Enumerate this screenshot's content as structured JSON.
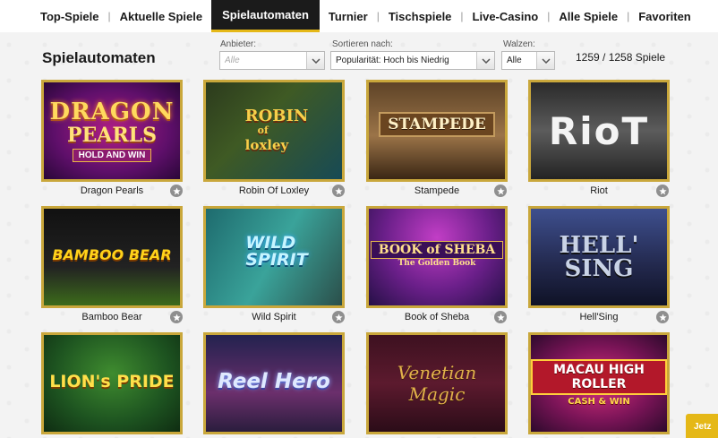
{
  "nav": {
    "items": [
      {
        "label": "Top-Spiele",
        "active": false
      },
      {
        "label": "Aktuelle Spiele",
        "active": false
      },
      {
        "label": "Spielautomaten",
        "active": true
      },
      {
        "label": "Turnier",
        "active": false
      },
      {
        "label": "Tischspiele",
        "active": false
      },
      {
        "label": "Live-Casino",
        "active": false
      },
      {
        "label": "Alle Spiele",
        "active": false
      },
      {
        "label": "Favoriten",
        "active": false
      }
    ],
    "separator": "|",
    "active_color": "#1b1b1b",
    "accent_color": "#e5b817"
  },
  "page": {
    "title": "Spielautomaten",
    "game_count": "1259 / 1258 Spiele"
  },
  "filters": {
    "provider": {
      "label": "Anbieter:",
      "placeholder": "Alle"
    },
    "sort": {
      "label": "Sortieren nach:",
      "value": "Popularität: Hoch bis Niedrig"
    },
    "reels": {
      "label": "Walzen:",
      "value": "Alle"
    }
  },
  "games": [
    {
      "title": "Dragon Pearls",
      "art_line1": "DRAGON",
      "art_line2": "PEARLS",
      "art_line3": "HOLD AND WIN"
    },
    {
      "title": "Robin Of Loxley",
      "art_line1": "ROBIN",
      "art_line2": "of",
      "art_line3": "loxley"
    },
    {
      "title": "Stampede",
      "art_line1": "STAMPEDE"
    },
    {
      "title": "Riot",
      "art_line1": "RioT"
    },
    {
      "title": "Bamboo Bear",
      "art_line1": "BAMBOO BEAR"
    },
    {
      "title": "Wild Spirit",
      "art_line1": "WILD",
      "art_line2": "SPIRIT"
    },
    {
      "title": "Book of Sheba",
      "art_line1": "BOOK of SHEBA",
      "art_line2": "The Golden Book"
    },
    {
      "title": "Hell'Sing",
      "art_line1": "HELL'",
      "art_line2": "SING"
    },
    {
      "title": "Lion's Pride",
      "art_line1": "LION's PRIDE"
    },
    {
      "title": "Reel Hero",
      "art_line1": "Reel Hero"
    },
    {
      "title": "Venetian Magic",
      "art_line1": "Venetian Magic"
    },
    {
      "title": "Macau High Roller",
      "art_line1": "MACAU HIGH ROLLER",
      "art_line2": "CASH & WIN"
    }
  ],
  "icons": {
    "favorite": "star-icon",
    "dropdown": "chevron-down-icon"
  },
  "cta": {
    "label": "Jetz"
  },
  "colors": {
    "tile_border": "#c9a73b",
    "favorite_button": "#8f8f8f",
    "cta": "#e5b817"
  }
}
